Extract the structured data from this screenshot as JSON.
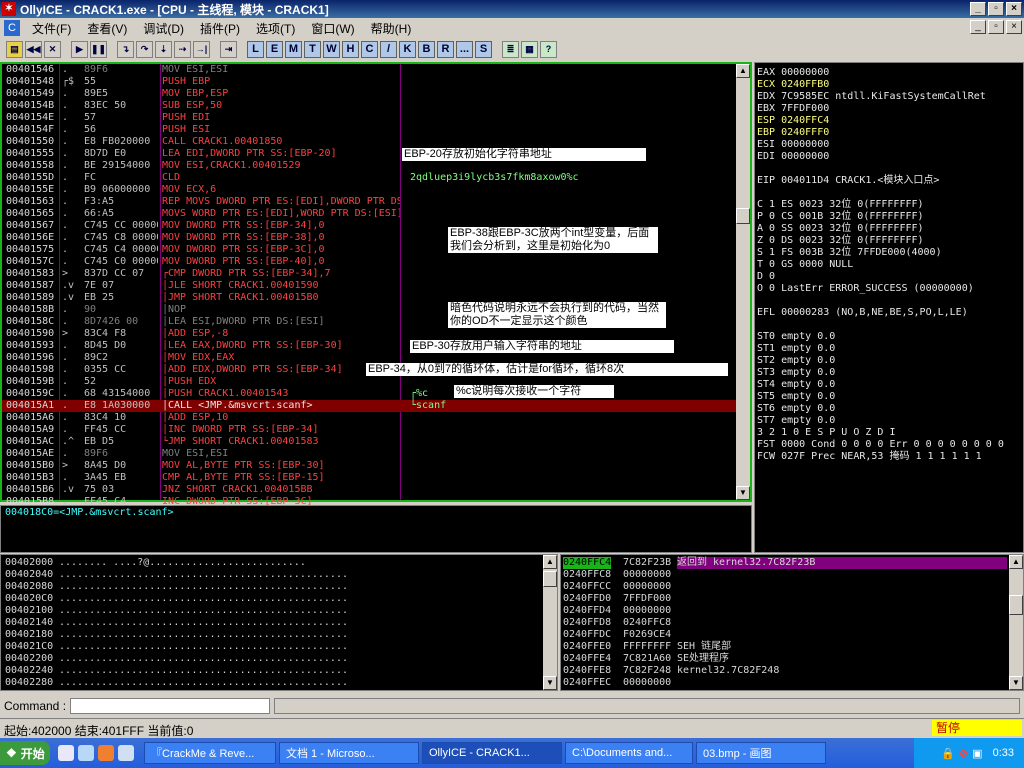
{
  "titlebar": {
    "text": "OllyICE - CRACK1.exe - [CPU - 主线程, 模块 - CRACK1]",
    "min": "_",
    "restore": "▫",
    "close": "×"
  },
  "menubar": {
    "cpu_icon": "C",
    "items": [
      "文件(F)",
      "查看(V)",
      "调试(D)",
      "插件(P)",
      "选项(T)",
      "窗口(W)",
      "帮助(H)"
    ],
    "win_buttons": [
      "_",
      "▫",
      "×"
    ]
  },
  "toolbar": {
    "icons": [
      "open",
      "restart",
      "close",
      "run",
      "pause",
      "stepin",
      "stepover",
      "trace-in",
      "trace-over",
      "till-return",
      "goto"
    ],
    "letters": [
      "L",
      "E",
      "M",
      "T",
      "W",
      "H",
      "C",
      "/",
      "K",
      "B",
      "R",
      "...",
      "S"
    ]
  },
  "cpu": {
    "rows": [
      {
        "addr": "00401546",
        "mark": ".",
        "hex": "89F6",
        "asm": "MOV ESI,ESI",
        "cls": "c-grey"
      },
      {
        "addr": "00401548",
        "mark": "┌$",
        "hex": "55",
        "asm": "PUSH EBP",
        "cls": "c-red"
      },
      {
        "addr": "00401549",
        "mark": ".",
        "hex": "89E5",
        "asm": "MOV EBP,ESP",
        "cls": "c-red"
      },
      {
        "addr": "0040154B",
        "mark": ".",
        "hex": "83EC 50",
        "asm": "SUB ESP,50",
        "cls": "c-red"
      },
      {
        "addr": "0040154E",
        "mark": ".",
        "hex": "57",
        "asm": "PUSH EDI",
        "cls": "c-red"
      },
      {
        "addr": "0040154F",
        "mark": ".",
        "hex": "56",
        "asm": "PUSH ESI",
        "cls": "c-red"
      },
      {
        "addr": "00401550",
        "mark": ".",
        "hex": "E8 FB020000",
        "asm": "CALL CRACK1.00401850",
        "cls": "c-red"
      },
      {
        "addr": "00401555",
        "mark": ".",
        "hex": "8D7D E0",
        "asm": "LEA EDI,DWORD PTR SS:[EBP-20]",
        "cls": "c-red"
      },
      {
        "addr": "00401558",
        "mark": ".",
        "hex": "BE 29154000",
        "asm": "MOV ESI,CRACK1.00401529",
        "cls": "c-red"
      },
      {
        "addr": "0040155D",
        "mark": ".",
        "hex": "FC",
        "asm": "CLD",
        "cls": "c-red"
      },
      {
        "addr": "0040155E",
        "mark": ".",
        "hex": "B9 06000000",
        "asm": "MOV ECX,6",
        "cls": "c-red"
      },
      {
        "addr": "00401563",
        "mark": ".",
        "hex": "F3:A5",
        "asm": "REP MOVS DWORD PTR ES:[EDI],DWORD PTR DS",
        "cls": "c-red"
      },
      {
        "addr": "00401565",
        "mark": ".",
        "hex": "66:A5",
        "asm": "MOVS WORD PTR ES:[EDI],WORD PTR DS:[ESI]",
        "cls": "c-red"
      },
      {
        "addr": "00401567",
        "mark": ".",
        "hex": "C745 CC 00000",
        "asm": "MOV DWORD PTR SS:[EBP-34],0",
        "cls": "c-red"
      },
      {
        "addr": "0040156E",
        "mark": ".",
        "hex": "C745 C8 00000",
        "asm": "MOV DWORD PTR SS:[EBP-38],0",
        "cls": "c-red"
      },
      {
        "addr": "00401575",
        "mark": ".",
        "hex": "C745 C4 00000",
        "asm": "MOV DWORD PTR SS:[EBP-3C],0",
        "cls": "c-red"
      },
      {
        "addr": "0040157C",
        "mark": ".",
        "hex": "C745 C0 00000",
        "asm": "MOV DWORD PTR SS:[EBP-40],0",
        "cls": "c-red"
      },
      {
        "addr": "00401583",
        "mark": ">",
        "hex": "837D CC 07",
        "asm": "┌CMP DWORD PTR SS:[EBP-34],7",
        "cls": "c-red"
      },
      {
        "addr": "00401587",
        "mark": ".v",
        "hex": "7E 07",
        "asm": "│JLE SHORT CRACK1.00401590",
        "cls": "c-red"
      },
      {
        "addr": "00401589",
        "mark": ".v",
        "hex": "EB 25",
        "asm": "│JMP SHORT CRACK1.004015B0",
        "cls": "c-red"
      },
      {
        "addr": "0040158B",
        "mark": ".",
        "hex": "90",
        "asm": "│NOP",
        "cls": "c-grey"
      },
      {
        "addr": "0040158C",
        "mark": ".",
        "hex": "8D7426 00",
        "asm": "│LEA ESI,DWORD PTR DS:[ESI]",
        "cls": "c-grey"
      },
      {
        "addr": "00401590",
        "mark": ">",
        "hex": "83C4 F8",
        "asm": "│ADD ESP,-8",
        "cls": "c-red"
      },
      {
        "addr": "00401593",
        "mark": ".",
        "hex": "8D45 D0",
        "asm": "│LEA EAX,DWORD PTR SS:[EBP-30]",
        "cls": "c-red"
      },
      {
        "addr": "00401596",
        "mark": ".",
        "hex": "89C2",
        "asm": "│MOV EDX,EAX",
        "cls": "c-red"
      },
      {
        "addr": "00401598",
        "mark": ".",
        "hex": "0355 CC",
        "asm": "│ADD EDX,DWORD PTR SS:[EBP-34]",
        "cls": "c-red"
      },
      {
        "addr": "0040159B",
        "mark": ".",
        "hex": "52",
        "asm": "│PUSH EDX",
        "cls": "c-red"
      },
      {
        "addr": "0040159C",
        "mark": ".",
        "hex": "68 43154000",
        "asm": "│PUSH CRACK1.00401543",
        "cls": "c-red"
      },
      {
        "addr": "004015A1",
        "mark": ".",
        "hex": "E8 1A030000",
        "asm": "│CALL <JMP.&msvcrt.scanf>",
        "cls": "c-white",
        "sel": true
      },
      {
        "addr": "004015A6",
        "mark": ".",
        "hex": "83C4 10",
        "asm": "│ADD ESP,10",
        "cls": "c-red"
      },
      {
        "addr": "004015A9",
        "mark": ".",
        "hex": "FF45 CC",
        "asm": "│INC DWORD PTR SS:[EBP-34]",
        "cls": "c-red"
      },
      {
        "addr": "004015AC",
        "mark": ".^",
        "hex": "EB D5",
        "asm": "└JMP SHORT CRACK1.00401583",
        "cls": "c-red"
      },
      {
        "addr": "004015AE",
        "mark": ".",
        "hex": "89F6",
        "asm": "MOV ESI,ESI",
        "cls": "c-grey"
      },
      {
        "addr": "004015B0",
        "mark": ">",
        "hex": "8A45 D0",
        "asm": "MOV AL,BYTE PTR SS:[EBP-30]",
        "cls": "c-red"
      },
      {
        "addr": "004015B3",
        "mark": ".",
        "hex": "3A45 EB",
        "asm": "CMP AL,BYTE PTR SS:[EBP-15]",
        "cls": "c-red"
      },
      {
        "addr": "004015B6",
        "mark": ".v",
        "hex": "75 03",
        "asm": "JNZ SHORT CRACK1.004015BB",
        "cls": "c-red"
      },
      {
        "addr": "004015B8",
        "mark": ".",
        "hex": "FF45 C4",
        "asm": "INC DWORD PTR SS:[EBP-3C]",
        "cls": "c-red"
      }
    ],
    "comments": [
      {
        "row": 9,
        "text": "2qdluep3i9lycb3s7fkm8axow0%c",
        "cls": "c-green"
      },
      {
        "row": 27,
        "text": "┌%c",
        "cls": "c-green"
      },
      {
        "row": 28,
        "text": "└scanf",
        "cls": "c-green"
      }
    ],
    "notes": [
      "EBP-20存放初始化字符串地址",
      "EBP-38跟EBP-3C放两个int型变量，后面我们会分析到，这里是初始化为0",
      "暗色代码说明永远不会执行到的代码，当然你的OD不一定显示这个颜色",
      "EBP-30存放用户输入字符串的地址",
      "EBP-34，从0到7的循环体，估计是for循环，循环8次",
      "%c说明每次接收一个字符"
    ]
  },
  "info": {
    "text": "004018C0=<JMP.&msvcrt.scanf>"
  },
  "registers": {
    "rows": [
      {
        "t": "EAX 00000000",
        "c": "c-white"
      },
      {
        "t": "ECX 0240FFB0",
        "c": "c-yellow"
      },
      {
        "t": "EDX 7C9585EC ntdll.KiFastSystemCallRet",
        "c": "c-white"
      },
      {
        "t": "EBX 7FFDF000",
        "c": "c-white"
      },
      {
        "t": "ESP 0240FFC4",
        "c": "c-yellow"
      },
      {
        "t": "EBP 0240FFF0",
        "c": "c-yellow"
      },
      {
        "t": "ESI 00000000",
        "c": "c-white"
      },
      {
        "t": "EDI 00000000",
        "c": "c-white"
      },
      {
        "t": "",
        "c": "c-white"
      },
      {
        "t": "EIP 004011D4 CRACK1.<模块入口点>",
        "c": "c-white"
      },
      {
        "t": "",
        "c": "c-white"
      },
      {
        "t": "C 1  ES 0023 32位 0(FFFFFFFF)",
        "c": "c-white"
      },
      {
        "t": "P 0  CS 001B 32位 0(FFFFFFFF)",
        "c": "c-white"
      },
      {
        "t": "A 0  SS 0023 32位 0(FFFFFFFF)",
        "c": "c-white"
      },
      {
        "t": "Z 0  DS 0023 32位 0(FFFFFFFF)",
        "c": "c-white"
      },
      {
        "t": "S 1  FS 003B 32位 7FFDE000(4000)",
        "c": "c-white"
      },
      {
        "t": "T 0  GS 0000 NULL",
        "c": "c-white"
      },
      {
        "t": "D 0",
        "c": "c-white"
      },
      {
        "t": "O 0  LastErr ERROR_SUCCESS (00000000)",
        "c": "c-white"
      },
      {
        "t": "",
        "c": "c-white"
      },
      {
        "t": "EFL 00000283 (NO,B,NE,BE,S,PO,L,LE)",
        "c": "c-white"
      },
      {
        "t": "",
        "c": "c-white"
      },
      {
        "t": "ST0 empty 0.0",
        "c": "c-white"
      },
      {
        "t": "ST1 empty 0.0",
        "c": "c-white"
      },
      {
        "t": "ST2 empty 0.0",
        "c": "c-white"
      },
      {
        "t": "ST3 empty 0.0",
        "c": "c-white"
      },
      {
        "t": "ST4 empty 0.0",
        "c": "c-white"
      },
      {
        "t": "ST5 empty 0.0",
        "c": "c-white"
      },
      {
        "t": "ST6 empty 0.0",
        "c": "c-white"
      },
      {
        "t": "ST7 empty 0.0",
        "c": "c-white"
      },
      {
        "t": "               3 2 1 0      E S P U O Z D I",
        "c": "c-white"
      },
      {
        "t": "FST 0000  Cond 0 0 0 0  Err 0 0 0 0 0 0 0 0",
        "c": "c-white"
      },
      {
        "t": "FCW 027F  Prec NEAR,53  掩码    1 1 1 1 1 1",
        "c": "c-white"
      }
    ]
  },
  "dump": {
    "rows": [
      {
        "addr": "00402000",
        "data": "........        ....?@.........................."
      },
      {
        "addr": "00402040",
        "data": "................................................"
      },
      {
        "addr": "00402080",
        "data": "................................................"
      },
      {
        "addr": "004020C0",
        "data": "................................................"
      },
      {
        "addr": "00402100",
        "data": "................................................"
      },
      {
        "addr": "00402140",
        "data": "................................................"
      },
      {
        "addr": "00402180",
        "data": "................................................"
      },
      {
        "addr": "004021C0",
        "data": "................................................"
      },
      {
        "addr": "00402200",
        "data": "................................................"
      },
      {
        "addr": "00402240",
        "data": "................................................"
      },
      {
        "addr": "00402280",
        "data": "................................................"
      }
    ]
  },
  "stack": {
    "rows": [
      {
        "addr": "0240FFC4",
        "val": "7C82F23B",
        "cmt": "返回到 kernel32.7C82F23B",
        "sel": true
      },
      {
        "addr": "0240FFC8",
        "val": "00000000",
        "cmt": ""
      },
      {
        "addr": "0240FFCC",
        "val": "00000000",
        "cmt": ""
      },
      {
        "addr": "0240FFD0",
        "val": "7FFDF000",
        "cmt": ""
      },
      {
        "addr": "0240FFD4",
        "val": "00000000",
        "cmt": ""
      },
      {
        "addr": "0240FFD8",
        "val": "0240FFC8",
        "cmt": ""
      },
      {
        "addr": "0240FFDC",
        "val": "F0269CE4",
        "cmt": ""
      },
      {
        "addr": "0240FFE0",
        "val": "FFFFFFFF",
        "cmt": "SEH 链尾部"
      },
      {
        "addr": "0240FFE4",
        "val": "7C821A60",
        "cmt": "SE处理程序"
      },
      {
        "addr": "0240FFE8",
        "val": "7C82F248",
        "cmt": "kernel32.7C82F248"
      },
      {
        "addr": "0240FFEC",
        "val": "00000000",
        "cmt": ""
      }
    ]
  },
  "command": {
    "label": "Command :"
  },
  "status": {
    "text": "起始:402000  结束:401FFF  当前值:0",
    "state": "暂停",
    "state_color": "#ffff00"
  },
  "taskbar": {
    "start": "开始",
    "tasks": [
      "『CrackMe & Reve...",
      "文档 1 - Microso...",
      "OllyICE - CRACK1...",
      "C:\\Documents and...",
      "03.bmp - 画图"
    ],
    "clock": "0:33"
  }
}
